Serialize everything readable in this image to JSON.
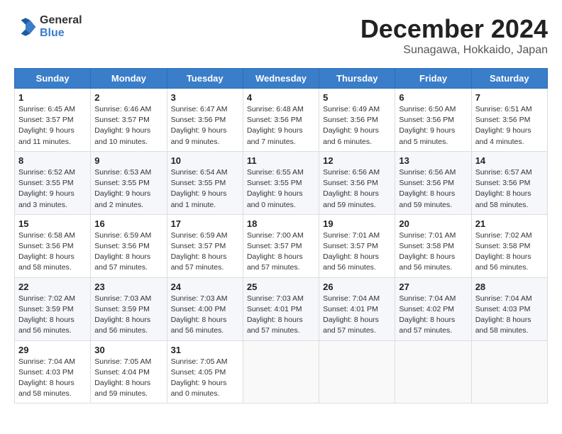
{
  "logo": {
    "general": "General",
    "blue": "Blue"
  },
  "header": {
    "month": "December 2024",
    "location": "Sunagawa, Hokkaido, Japan"
  },
  "days_of_week": [
    "Sunday",
    "Monday",
    "Tuesday",
    "Wednesday",
    "Thursday",
    "Friday",
    "Saturday"
  ],
  "weeks": [
    [
      {
        "day": 1,
        "info": "Sunrise: 6:45 AM\nSunset: 3:57 PM\nDaylight: 9 hours\nand 11 minutes."
      },
      {
        "day": 2,
        "info": "Sunrise: 6:46 AM\nSunset: 3:57 PM\nDaylight: 9 hours\nand 10 minutes."
      },
      {
        "day": 3,
        "info": "Sunrise: 6:47 AM\nSunset: 3:56 PM\nDaylight: 9 hours\nand 9 minutes."
      },
      {
        "day": 4,
        "info": "Sunrise: 6:48 AM\nSunset: 3:56 PM\nDaylight: 9 hours\nand 7 minutes."
      },
      {
        "day": 5,
        "info": "Sunrise: 6:49 AM\nSunset: 3:56 PM\nDaylight: 9 hours\nand 6 minutes."
      },
      {
        "day": 6,
        "info": "Sunrise: 6:50 AM\nSunset: 3:56 PM\nDaylight: 9 hours\nand 5 minutes."
      },
      {
        "day": 7,
        "info": "Sunrise: 6:51 AM\nSunset: 3:56 PM\nDaylight: 9 hours\nand 4 minutes."
      }
    ],
    [
      {
        "day": 8,
        "info": "Sunrise: 6:52 AM\nSunset: 3:55 PM\nDaylight: 9 hours\nand 3 minutes."
      },
      {
        "day": 9,
        "info": "Sunrise: 6:53 AM\nSunset: 3:55 PM\nDaylight: 9 hours\nand 2 minutes."
      },
      {
        "day": 10,
        "info": "Sunrise: 6:54 AM\nSunset: 3:55 PM\nDaylight: 9 hours\nand 1 minute."
      },
      {
        "day": 11,
        "info": "Sunrise: 6:55 AM\nSunset: 3:55 PM\nDaylight: 9 hours\nand 0 minutes."
      },
      {
        "day": 12,
        "info": "Sunrise: 6:56 AM\nSunset: 3:56 PM\nDaylight: 8 hours\nand 59 minutes."
      },
      {
        "day": 13,
        "info": "Sunrise: 6:56 AM\nSunset: 3:56 PM\nDaylight: 8 hours\nand 59 minutes."
      },
      {
        "day": 14,
        "info": "Sunrise: 6:57 AM\nSunset: 3:56 PM\nDaylight: 8 hours\nand 58 minutes."
      }
    ],
    [
      {
        "day": 15,
        "info": "Sunrise: 6:58 AM\nSunset: 3:56 PM\nDaylight: 8 hours\nand 58 minutes."
      },
      {
        "day": 16,
        "info": "Sunrise: 6:59 AM\nSunset: 3:56 PM\nDaylight: 8 hours\nand 57 minutes."
      },
      {
        "day": 17,
        "info": "Sunrise: 6:59 AM\nSunset: 3:57 PM\nDaylight: 8 hours\nand 57 minutes."
      },
      {
        "day": 18,
        "info": "Sunrise: 7:00 AM\nSunset: 3:57 PM\nDaylight: 8 hours\nand 57 minutes."
      },
      {
        "day": 19,
        "info": "Sunrise: 7:01 AM\nSunset: 3:57 PM\nDaylight: 8 hours\nand 56 minutes."
      },
      {
        "day": 20,
        "info": "Sunrise: 7:01 AM\nSunset: 3:58 PM\nDaylight: 8 hours\nand 56 minutes."
      },
      {
        "day": 21,
        "info": "Sunrise: 7:02 AM\nSunset: 3:58 PM\nDaylight: 8 hours\nand 56 minutes."
      }
    ],
    [
      {
        "day": 22,
        "info": "Sunrise: 7:02 AM\nSunset: 3:59 PM\nDaylight: 8 hours\nand 56 minutes."
      },
      {
        "day": 23,
        "info": "Sunrise: 7:03 AM\nSunset: 3:59 PM\nDaylight: 8 hours\nand 56 minutes."
      },
      {
        "day": 24,
        "info": "Sunrise: 7:03 AM\nSunset: 4:00 PM\nDaylight: 8 hours\nand 56 minutes."
      },
      {
        "day": 25,
        "info": "Sunrise: 7:03 AM\nSunset: 4:01 PM\nDaylight: 8 hours\nand 57 minutes."
      },
      {
        "day": 26,
        "info": "Sunrise: 7:04 AM\nSunset: 4:01 PM\nDaylight: 8 hours\nand 57 minutes."
      },
      {
        "day": 27,
        "info": "Sunrise: 7:04 AM\nSunset: 4:02 PM\nDaylight: 8 hours\nand 57 minutes."
      },
      {
        "day": 28,
        "info": "Sunrise: 7:04 AM\nSunset: 4:03 PM\nDaylight: 8 hours\nand 58 minutes."
      }
    ],
    [
      {
        "day": 29,
        "info": "Sunrise: 7:04 AM\nSunset: 4:03 PM\nDaylight: 8 hours\nand 58 minutes."
      },
      {
        "day": 30,
        "info": "Sunrise: 7:05 AM\nSunset: 4:04 PM\nDaylight: 8 hours\nand 59 minutes."
      },
      {
        "day": 31,
        "info": "Sunrise: 7:05 AM\nSunset: 4:05 PM\nDaylight: 9 hours\nand 0 minutes."
      },
      null,
      null,
      null,
      null
    ]
  ]
}
